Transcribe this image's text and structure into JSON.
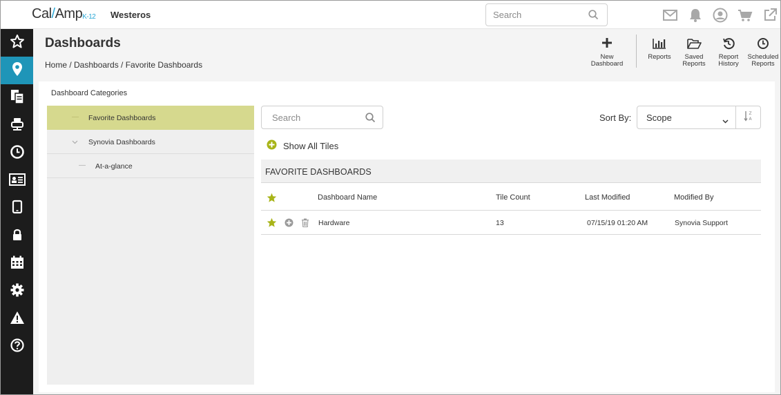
{
  "app": {
    "logo_text_left": "Cal",
    "logo_slash": "/",
    "logo_text_right": "Amp",
    "logo_suffix": "K-12",
    "district": "Westeros",
    "search_placeholder": "Search"
  },
  "top_icons": [
    "mail-icon",
    "bell-icon",
    "user-icon",
    "cart-icon",
    "external-link-icon"
  ],
  "sidebar": {
    "items": [
      {
        "name": "favorites",
        "icon": "star-icon",
        "active": false
      },
      {
        "name": "location",
        "icon": "map-pin-icon",
        "active": true
      },
      {
        "name": "documents",
        "icon": "documents-icon",
        "active": false
      },
      {
        "name": "devices",
        "icon": "cart-icon",
        "active": false
      },
      {
        "name": "history",
        "icon": "clock-icon",
        "active": false
      },
      {
        "name": "id-card",
        "icon": "id-card-icon",
        "active": false
      },
      {
        "name": "tablet",
        "icon": "tablet-icon",
        "active": false
      },
      {
        "name": "security",
        "icon": "lock-icon",
        "active": false
      },
      {
        "name": "calendar",
        "icon": "calendar-icon",
        "active": false
      },
      {
        "name": "settings",
        "icon": "gear-icon",
        "active": false
      },
      {
        "name": "alerts",
        "icon": "warning-icon",
        "active": false
      },
      {
        "name": "help",
        "icon": "help-icon",
        "active": false
      }
    ],
    "active_color": "#1f95b8"
  },
  "header": {
    "title": "Dashboards",
    "breadcrumb": "Home / Dashboards / Favorite Dashboards"
  },
  "toolbar": {
    "new_dashboard_line1": "New",
    "new_dashboard_line2": "Dashboard",
    "reports": "Reports",
    "saved_reports_line1": "Saved",
    "saved_reports_line2": "Reports",
    "report_history_line1": "Report",
    "report_history_line2": "History",
    "scheduled_reports_line1": "Scheduled",
    "scheduled_reports_line2": "Reports"
  },
  "categories": {
    "title": "Dashboard Categories",
    "items": [
      {
        "label": "Favorite Dashboards",
        "selected": true
      },
      {
        "label": "Synovia Dashboards",
        "selected": false
      },
      {
        "label": "At-a-glance",
        "selected": false
      }
    ],
    "selected_color": "#d6d98e"
  },
  "main": {
    "search_placeholder": "Search",
    "sort_label": "Sort By:",
    "sort_value": "Scope",
    "show_all_tiles": "Show All Tiles",
    "section_title": "FAVORITE DASHBOARDS",
    "accent_color": "#a8b418"
  },
  "table": {
    "columns": [
      "Dashboard Name",
      "Tile Count",
      "Last Modified",
      "Modified By"
    ],
    "rows": [
      {
        "name": "Hardware",
        "tile_count": "13",
        "last_modified": "07/15/19 01:20 AM",
        "modified_by": "Synovia Support"
      }
    ]
  }
}
